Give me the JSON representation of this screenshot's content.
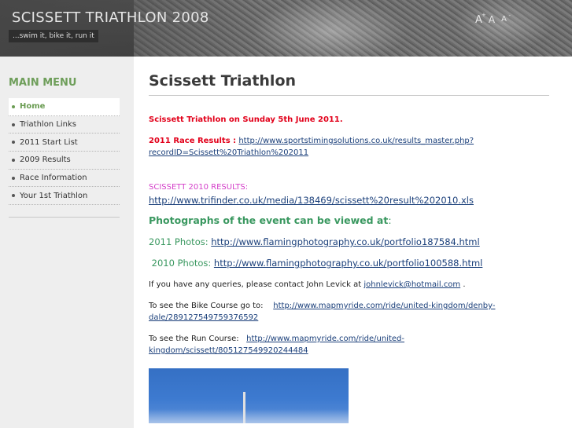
{
  "header": {
    "site_title": "SCISSETT TRIATHLON 2008",
    "slogan": "...swim it, bike it, run it",
    "font_size_large": "A",
    "font_size_large_sup": "+",
    "font_size_normal": "A",
    "font_size_small": "A",
    "font_size_small_sup": "-"
  },
  "sidebar": {
    "menu_title": "MAIN MENU",
    "items": [
      {
        "label": "Home",
        "active": true
      },
      {
        "label": "Triathlon Links",
        "active": false
      },
      {
        "label": "2011 Start List",
        "active": false
      },
      {
        "label": "2009 Results",
        "active": false
      },
      {
        "label": "Race Information",
        "active": false
      },
      {
        "label": "Your 1st Triathlon",
        "active": false
      }
    ]
  },
  "main": {
    "title": "Scissett Triathlon",
    "event_date": "Scissett Triathlon on Sunday 5th June 2011.",
    "results_2011_label": "2011 Race Results :",
    "results_2011_link_line1": "http://www.sportstimingsolutions.co.uk/results_master.php?",
    "results_2011_link_line2": "recordID=Scissett%20Triathlon%202011",
    "results_2010_label": "SCISSETT 2010 RESULTS:",
    "results_2010_link": "http://www.trifinder.co.uk/media/138469/scissett%20result%202010.xls",
    "photos_heading": "Photographs of the event can be viewed at",
    "photos_heading_colon": ":",
    "photos_2011_label": "2011 Photos:",
    "photos_2011_link": "http://www.flamingphotography.co.uk/portfolio187584.html",
    "photos_2010_label": "2010 Photos:",
    "photos_2010_link": "http://www.flamingphotography.co.uk/portfolio100588.html",
    "queries_text": "If you have any queries, please contact John Levick at",
    "queries_email": "johnlevick@hotmail.com",
    "queries_end": ".",
    "bike_label": "To see the Bike Course go to:",
    "bike_link_line1": "http://www.mapmyride.com/ride/united-kingdom/denby-",
    "bike_link_line2": "dale/289127549759376592",
    "run_label": "To see the Run Course:",
    "run_link_line1": "http://www.mapmyride.com/ride/united-",
    "run_link_line2": "kingdom/scissett/805127549920244484"
  },
  "colors": {
    "header_bg": "#4a4a4a",
    "sidebar_bg": "#eeeeee",
    "menu_accent": "#6a9c52",
    "alert_red": "#e2001a",
    "magenta": "#d43fc9",
    "green_text": "#3a9860",
    "link": "#1a3f7a"
  }
}
